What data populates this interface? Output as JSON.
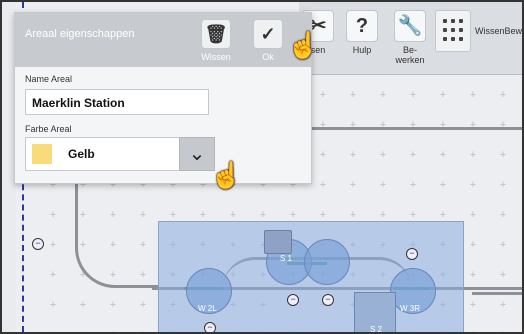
{
  "panel": {
    "title": "Areaal eigenschappen",
    "delete_label": "Wissen",
    "ok_label": "Ok",
    "name_label": "Name Areal",
    "name_value": "Maerklin Station",
    "color_label": "Farbe Areal",
    "color_value": "Gelb",
    "color_swatch": "#f8dc7a"
  },
  "toolbar": {
    "cut_label": "sen",
    "help_label": "Hulp",
    "edit_label_1": "Be-",
    "edit_label_2": "werken",
    "wissen_bewerk": "WissenBewe"
  },
  "layout": {
    "nodes": [
      "W 2L",
      "W 3R",
      "S 2",
      "S 1"
    ]
  },
  "icons": {
    "delete": "trash-icon",
    "ok": "check-icon",
    "help": "question-icon",
    "edit": "wrench-icon",
    "grid": "grid-icon",
    "dropdown": "chevron-down-icon",
    "pointer": "hand-pointer-icon"
  }
}
